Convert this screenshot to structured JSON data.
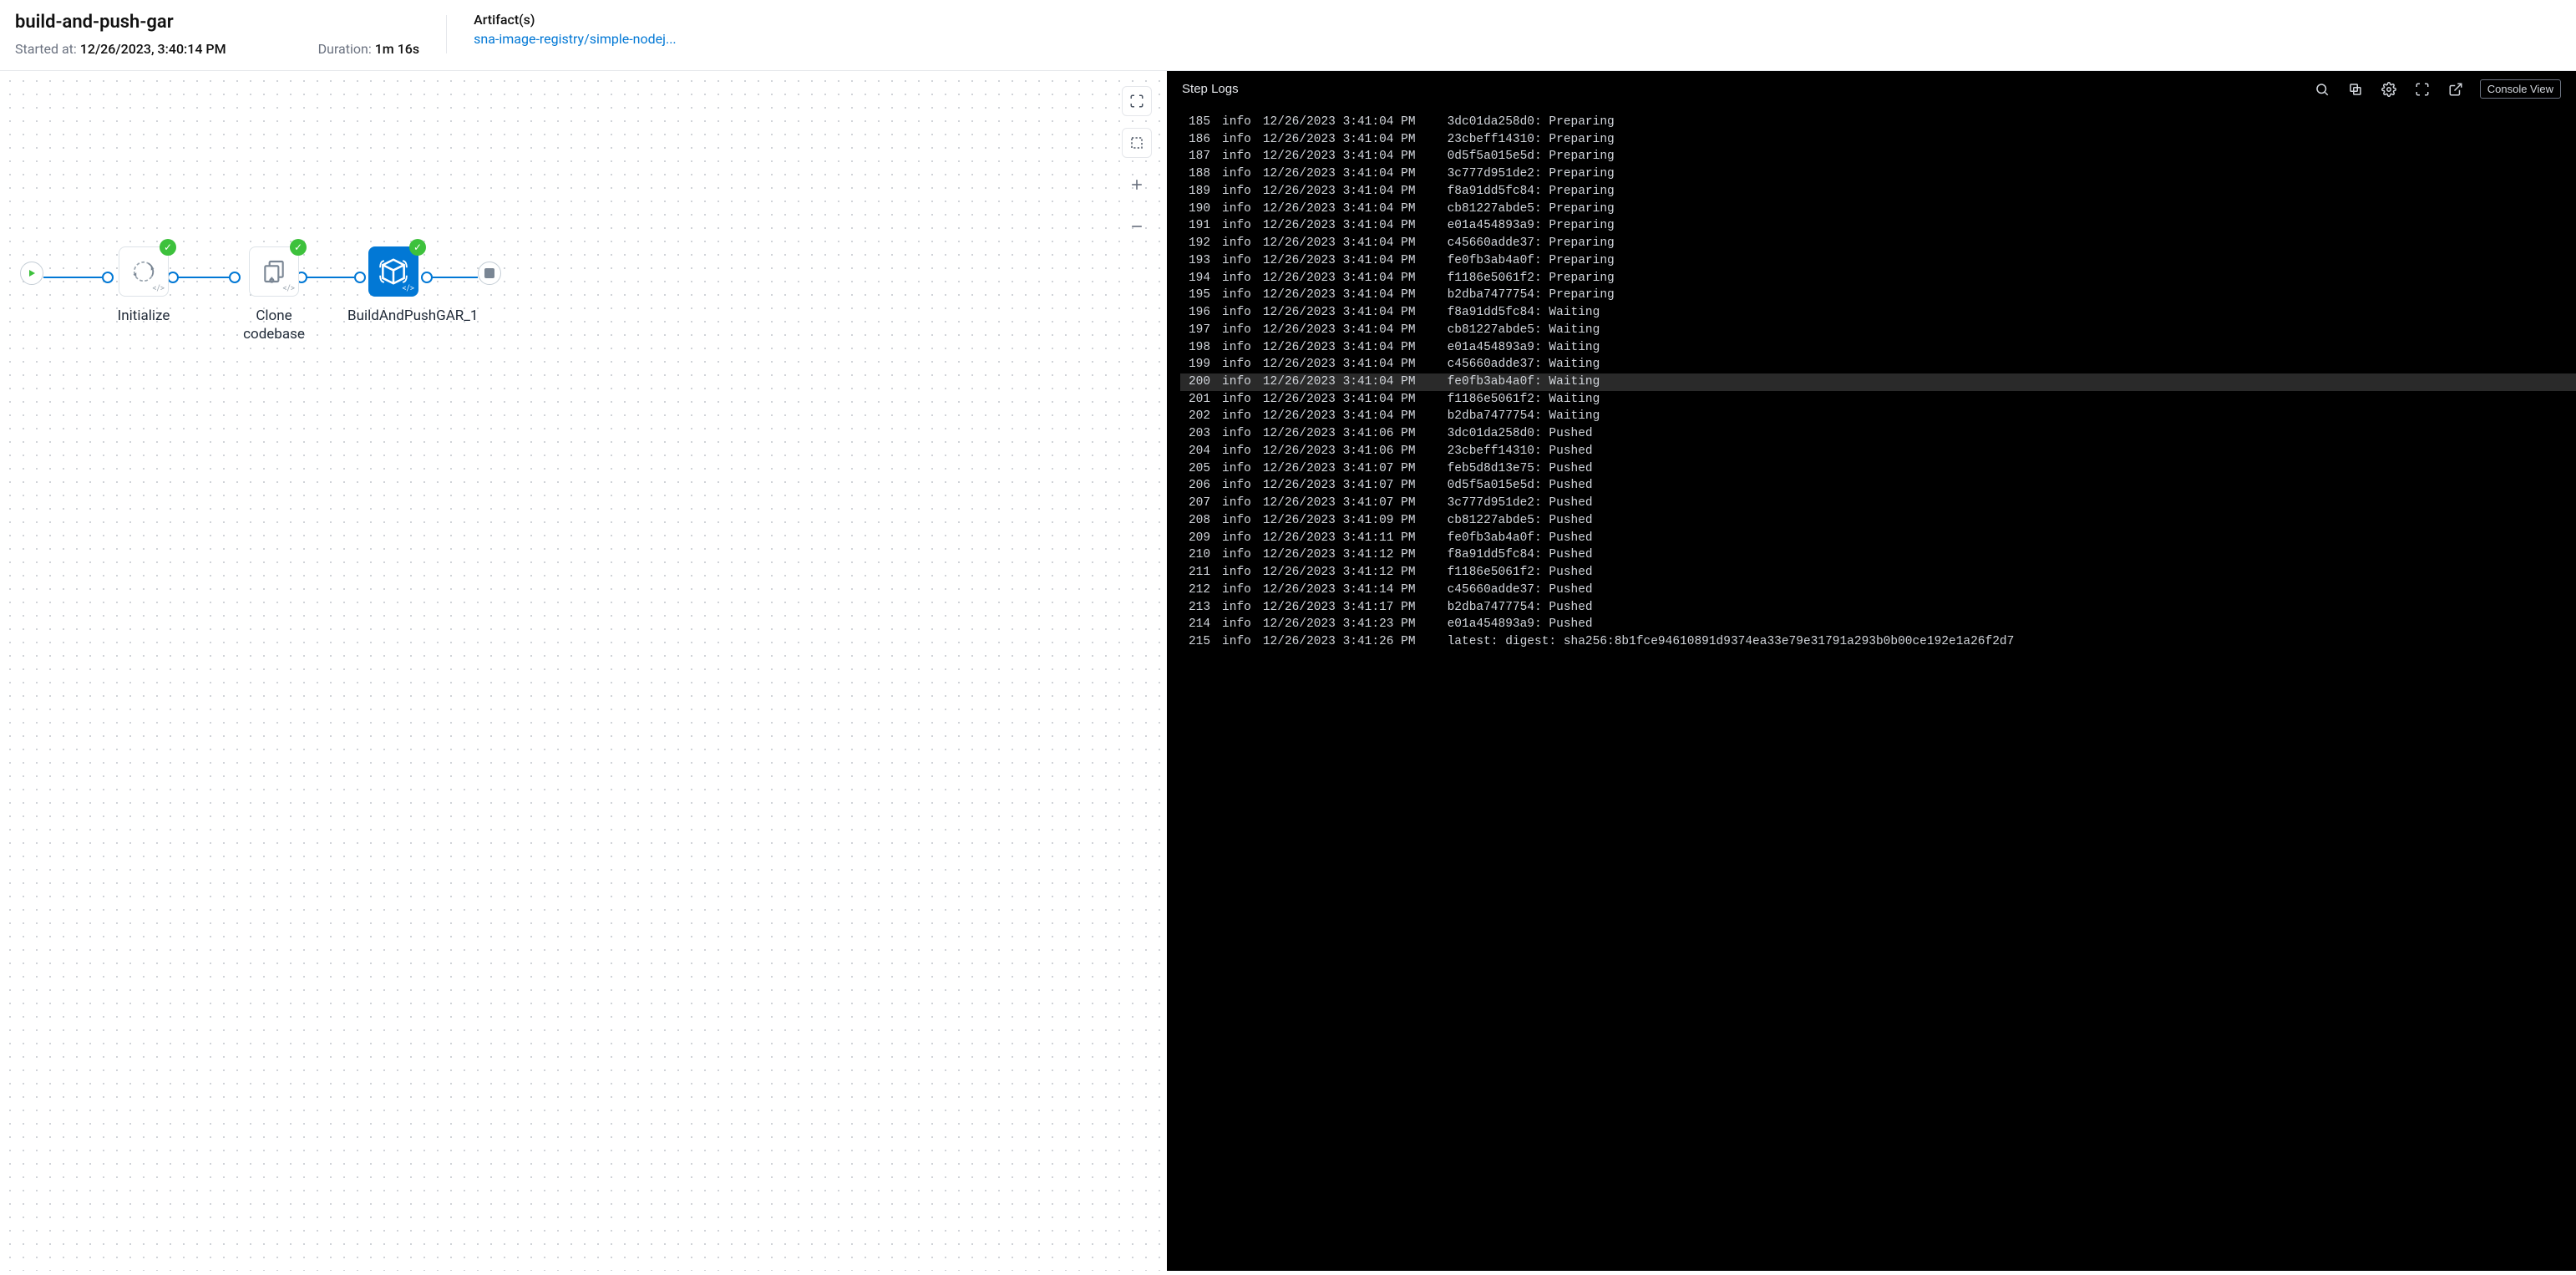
{
  "header": {
    "title": "build-and-push-gar",
    "started_label": "Started at:",
    "started_value": "12/26/2023, 3:40:14 PM",
    "duration_label": "Duration:",
    "duration_value": "1m 16s",
    "artifacts_title": "Artifact(s)",
    "artifacts_link": "sna-image-registry/simple-nodej..."
  },
  "steps": [
    {
      "label": "Initialize"
    },
    {
      "label": "Clone codebase"
    },
    {
      "label": "BuildAndPushGAR_1"
    }
  ],
  "logs": {
    "title": "Step Logs",
    "console_btn": "Console View",
    "lines": [
      {
        "n": 185,
        "level": "info",
        "ts": "12/26/2023 3:41:04 PM",
        "msg": "3dc01da258d0: Preparing"
      },
      {
        "n": 186,
        "level": "info",
        "ts": "12/26/2023 3:41:04 PM",
        "msg": "23cbeff14310: Preparing"
      },
      {
        "n": 187,
        "level": "info",
        "ts": "12/26/2023 3:41:04 PM",
        "msg": "0d5f5a015e5d: Preparing"
      },
      {
        "n": 188,
        "level": "info",
        "ts": "12/26/2023 3:41:04 PM",
        "msg": "3c777d951de2: Preparing"
      },
      {
        "n": 189,
        "level": "info",
        "ts": "12/26/2023 3:41:04 PM",
        "msg": "f8a91dd5fc84: Preparing"
      },
      {
        "n": 190,
        "level": "info",
        "ts": "12/26/2023 3:41:04 PM",
        "msg": "cb81227abde5: Preparing"
      },
      {
        "n": 191,
        "level": "info",
        "ts": "12/26/2023 3:41:04 PM",
        "msg": "e01a454893a9: Preparing"
      },
      {
        "n": 192,
        "level": "info",
        "ts": "12/26/2023 3:41:04 PM",
        "msg": "c45660adde37: Preparing"
      },
      {
        "n": 193,
        "level": "info",
        "ts": "12/26/2023 3:41:04 PM",
        "msg": "fe0fb3ab4a0f: Preparing"
      },
      {
        "n": 194,
        "level": "info",
        "ts": "12/26/2023 3:41:04 PM",
        "msg": "f1186e5061f2: Preparing"
      },
      {
        "n": 195,
        "level": "info",
        "ts": "12/26/2023 3:41:04 PM",
        "msg": "b2dba7477754: Preparing"
      },
      {
        "n": 196,
        "level": "info",
        "ts": "12/26/2023 3:41:04 PM",
        "msg": "f8a91dd5fc84: Waiting"
      },
      {
        "n": 197,
        "level": "info",
        "ts": "12/26/2023 3:41:04 PM",
        "msg": "cb81227abde5: Waiting"
      },
      {
        "n": 198,
        "level": "info",
        "ts": "12/26/2023 3:41:04 PM",
        "msg": "e01a454893a9: Waiting"
      },
      {
        "n": 199,
        "level": "info",
        "ts": "12/26/2023 3:41:04 PM",
        "msg": "c45660adde37: Waiting"
      },
      {
        "n": 200,
        "level": "info",
        "ts": "12/26/2023 3:41:04 PM",
        "msg": "fe0fb3ab4a0f: Waiting",
        "hl": true
      },
      {
        "n": 201,
        "level": "info",
        "ts": "12/26/2023 3:41:04 PM",
        "msg": "f1186e5061f2: Waiting"
      },
      {
        "n": 202,
        "level": "info",
        "ts": "12/26/2023 3:41:04 PM",
        "msg": "b2dba7477754: Waiting"
      },
      {
        "n": 203,
        "level": "info",
        "ts": "12/26/2023 3:41:06 PM",
        "msg": "3dc01da258d0: Pushed"
      },
      {
        "n": 204,
        "level": "info",
        "ts": "12/26/2023 3:41:06 PM",
        "msg": "23cbeff14310: Pushed"
      },
      {
        "n": 205,
        "level": "info",
        "ts": "12/26/2023 3:41:07 PM",
        "msg": "feb5d8d13e75: Pushed"
      },
      {
        "n": 206,
        "level": "info",
        "ts": "12/26/2023 3:41:07 PM",
        "msg": "0d5f5a015e5d: Pushed"
      },
      {
        "n": 207,
        "level": "info",
        "ts": "12/26/2023 3:41:07 PM",
        "msg": "3c777d951de2: Pushed"
      },
      {
        "n": 208,
        "level": "info",
        "ts": "12/26/2023 3:41:09 PM",
        "msg": "cb81227abde5: Pushed"
      },
      {
        "n": 209,
        "level": "info",
        "ts": "12/26/2023 3:41:11 PM",
        "msg": "fe0fb3ab4a0f: Pushed"
      },
      {
        "n": 210,
        "level": "info",
        "ts": "12/26/2023 3:41:12 PM",
        "msg": "f8a91dd5fc84: Pushed"
      },
      {
        "n": 211,
        "level": "info",
        "ts": "12/26/2023 3:41:12 PM",
        "msg": "f1186e5061f2: Pushed"
      },
      {
        "n": 212,
        "level": "info",
        "ts": "12/26/2023 3:41:14 PM",
        "msg": "c45660adde37: Pushed"
      },
      {
        "n": 213,
        "level": "info",
        "ts": "12/26/2023 3:41:17 PM",
        "msg": "b2dba7477754: Pushed"
      },
      {
        "n": 214,
        "level": "info",
        "ts": "12/26/2023 3:41:23 PM",
        "msg": "e01a454893a9: Pushed"
      },
      {
        "n": 215,
        "level": "info",
        "ts": "12/26/2023 3:41:26 PM",
        "msg": "latest: digest: sha256:8b1fce94610891d9374ea33e79e31791a293b0b00ce192e1a26f2d7"
      }
    ]
  }
}
